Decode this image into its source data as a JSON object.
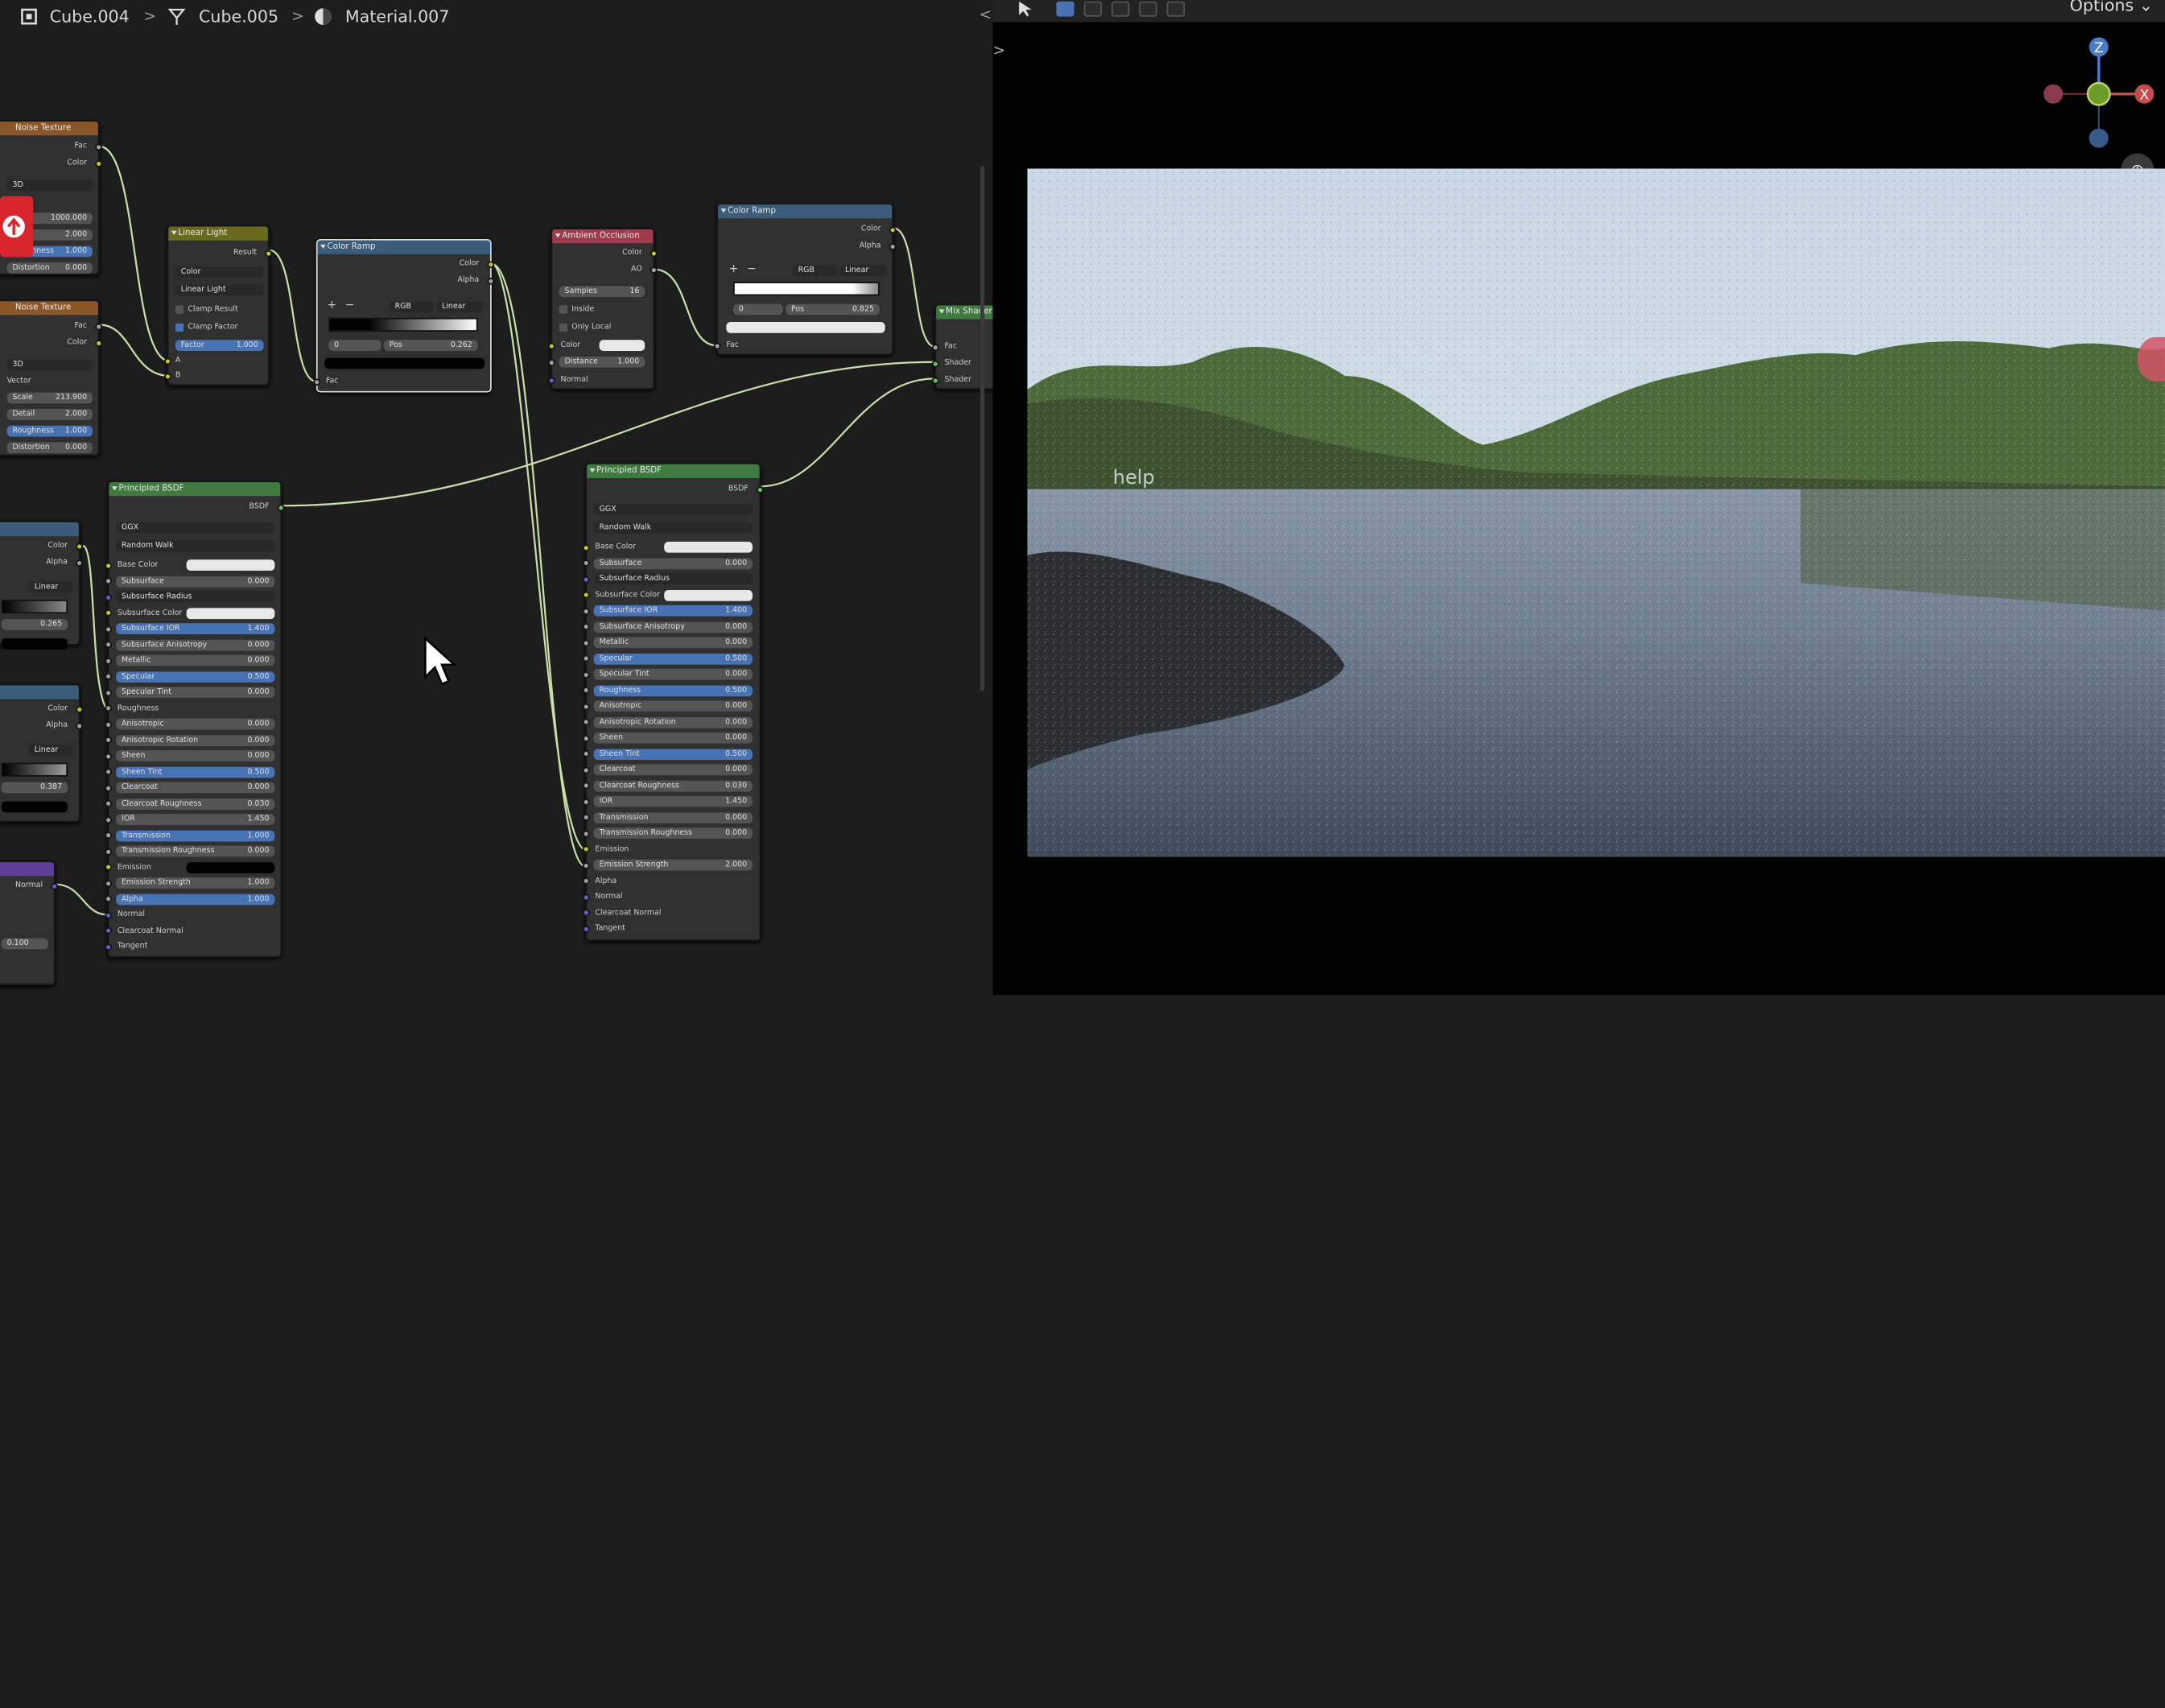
{
  "breadcrumb": {
    "object": "Cube.004",
    "mesh": "Cube.005",
    "material": "Material.007"
  },
  "viewport": {
    "options_label": "Options",
    "axis_z": "Z",
    "axis_x": "X",
    "overlay_text": "help"
  },
  "noise1": {
    "title": "Noise Texture",
    "out_fac": "Fac",
    "out_color": "Color",
    "dim": "3D",
    "w_val": "1000.000",
    "scale_val": "2.000",
    "roughness_label": "Roughness",
    "roughness_val": "1.000",
    "distortion_label": "Distortion",
    "distortion_val": "0.000"
  },
  "noise2": {
    "title": "Noise Texture",
    "out_fac": "Fac",
    "out_color": "Color",
    "dim": "3D",
    "vector": "Vector",
    "scale_label": "Scale",
    "scale_val": "213.900",
    "detail_label": "Detail",
    "detail_val": "2.000",
    "roughness_label": "Roughness",
    "roughness_val": "1.000",
    "distortion_label": "Distortion",
    "distortion_val": "0.000"
  },
  "mix": {
    "title": "Linear Light",
    "out": "Result",
    "type": "Color",
    "blend": "Linear Light",
    "clamp_result": "Clamp Result",
    "clamp_factor": "Clamp Factor",
    "factor_label": "Factor",
    "factor_val": "1.000",
    "in_a": "A",
    "in_b": "B"
  },
  "ramp1": {
    "title": "Color Ramp",
    "out_color": "Color",
    "out_alpha": "Alpha",
    "add": "+",
    "remove": "−",
    "mode": "RGB",
    "interp": "Linear",
    "index": "0",
    "pos_label": "Pos",
    "pos_val": "0.262",
    "in_fac": "Fac"
  },
  "ao": {
    "title": "Ambient Occlusion",
    "out_color": "Color",
    "out_ao": "AO",
    "samples_label": "Samples",
    "samples_val": "16",
    "inside": "Inside",
    "only_local": "Only Local",
    "color": "Color",
    "distance_label": "Distance",
    "distance_val": "1.000",
    "normal": "Normal"
  },
  "ramp2": {
    "title": "Color Ramp",
    "out_color": "Color",
    "out_alpha": "Alpha",
    "add": "+",
    "remove": "−",
    "mode": "RGB",
    "interp": "Linear",
    "index": "0",
    "pos_label": "Pos",
    "pos_val": "0.825",
    "in_fac": "Fac"
  },
  "mixshader": {
    "title": "Mix Shader",
    "fac": "Fac",
    "shader1": "Shader",
    "shader2": "Shader"
  },
  "leftramps": {
    "color": "Color",
    "alpha": "Alpha",
    "linear": "Linear",
    "pos1": "0.265",
    "pos2": "0.387",
    "normal": "Normal",
    "val": "0.100"
  },
  "bsdf1": {
    "title": "Principled BSDF",
    "out": "BSDF",
    "dist": "GGX",
    "sss": "Random Walk",
    "rows": [
      {
        "label": "Base Color",
        "val": "",
        "kind": "white"
      },
      {
        "label": "Subsurface",
        "val": "0.000",
        "kind": "field"
      },
      {
        "label": "Subsurface Radius",
        "val": "",
        "kind": "sel"
      },
      {
        "label": "Subsurface Color",
        "val": "",
        "kind": "white"
      },
      {
        "label": "Subsurface IOR",
        "val": "1.400",
        "kind": "blue"
      },
      {
        "label": "Subsurface Anisotropy",
        "val": "0.000",
        "kind": "field"
      },
      {
        "label": "Metallic",
        "val": "0.000",
        "kind": "field"
      },
      {
        "label": "Specular",
        "val": "0.500",
        "kind": "blue"
      },
      {
        "label": "Specular Tint",
        "val": "0.000",
        "kind": "field"
      },
      {
        "label": "Roughness",
        "val": "",
        "kind": "label"
      },
      {
        "label": "Anisotropic",
        "val": "0.000",
        "kind": "field"
      },
      {
        "label": "Anisotropic Rotation",
        "val": "0.000",
        "kind": "field"
      },
      {
        "label": "Sheen",
        "val": "0.000",
        "kind": "field"
      },
      {
        "label": "Sheen Tint",
        "val": "0.500",
        "kind": "blue"
      },
      {
        "label": "Clearcoat",
        "val": "0.000",
        "kind": "field"
      },
      {
        "label": "Clearcoat Roughness",
        "val": "0.030",
        "kind": "field"
      },
      {
        "label": "IOR",
        "val": "1.450",
        "kind": "field"
      },
      {
        "label": "Transmission",
        "val": "1.000",
        "kind": "blue"
      },
      {
        "label": "Transmission Roughness",
        "val": "0.000",
        "kind": "field"
      },
      {
        "label": "Emission",
        "val": "",
        "kind": "black"
      },
      {
        "label": "Emission Strength",
        "val": "1.000",
        "kind": "field"
      },
      {
        "label": "Alpha",
        "val": "1.000",
        "kind": "blue"
      },
      {
        "label": "Normal",
        "val": "",
        "kind": "label"
      },
      {
        "label": "Clearcoat Normal",
        "val": "",
        "kind": "label"
      },
      {
        "label": "Tangent",
        "val": "",
        "kind": "label"
      }
    ]
  },
  "bsdf2": {
    "title": "Principled BSDF",
    "out": "BSDF",
    "dist": "GGX",
    "sss": "Random Walk",
    "rows": [
      {
        "label": "Base Color",
        "val": "",
        "kind": "white"
      },
      {
        "label": "Subsurface",
        "val": "0.000",
        "kind": "field"
      },
      {
        "label": "Subsurface Radius",
        "val": "",
        "kind": "sel"
      },
      {
        "label": "Subsurface Color",
        "val": "",
        "kind": "white"
      },
      {
        "label": "Subsurface IOR",
        "val": "1.400",
        "kind": "blue"
      },
      {
        "label": "Subsurface Anisotropy",
        "val": "0.000",
        "kind": "field"
      },
      {
        "label": "Metallic",
        "val": "0.000",
        "kind": "field"
      },
      {
        "label": "Specular",
        "val": "0.500",
        "kind": "blue"
      },
      {
        "label": "Specular Tint",
        "val": "0.000",
        "kind": "field"
      },
      {
        "label": "Roughness",
        "val": "0.500",
        "kind": "blue"
      },
      {
        "label": "Anisotropic",
        "val": "0.000",
        "kind": "field"
      },
      {
        "label": "Anisotropic Rotation",
        "val": "0.000",
        "kind": "field"
      },
      {
        "label": "Sheen",
        "val": "0.000",
        "kind": "field"
      },
      {
        "label": "Sheen Tint",
        "val": "0.500",
        "kind": "blue"
      },
      {
        "label": "Clearcoat",
        "val": "0.000",
        "kind": "field"
      },
      {
        "label": "Clearcoat Roughness",
        "val": "0.030",
        "kind": "field"
      },
      {
        "label": "IOR",
        "val": "1.450",
        "kind": "field"
      },
      {
        "label": "Transmission",
        "val": "0.000",
        "kind": "field"
      },
      {
        "label": "Transmission Roughness",
        "val": "0.000",
        "kind": "field"
      },
      {
        "label": "Emission",
        "val": "",
        "kind": "label"
      },
      {
        "label": "Emission Strength",
        "val": "2.000",
        "kind": "field"
      },
      {
        "label": "Alpha",
        "val": "",
        "kind": "label"
      },
      {
        "label": "Normal",
        "val": "",
        "kind": "label"
      },
      {
        "label": "Clearcoat Normal",
        "val": "",
        "kind": "label"
      },
      {
        "label": "Tangent",
        "val": "",
        "kind": "label"
      }
    ]
  },
  "colors": {
    "header_texture": "#8b5628",
    "header_converter": "#3b5c7a",
    "header_shader": "#3f7a3f",
    "header_mix": "#6a6a1f",
    "header_ao": "#9e3a4a",
    "link": "#c8e0a8"
  }
}
